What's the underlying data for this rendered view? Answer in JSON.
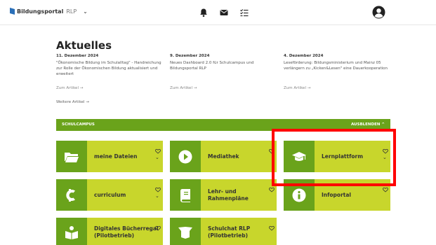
{
  "header": {
    "brand_bold": "Bildungsportal",
    "brand_suffix": "RLP",
    "icons": [
      "bell-icon",
      "mail-icon",
      "tasks-icon",
      "user-avatar-icon"
    ]
  },
  "news": {
    "title": "Aktuelles",
    "items": [
      {
        "date": "11. Dezember 2024",
        "text": "\"Ökonomische Bildung im Schulalltag\" - Handreichung zur Rolle der Ökonomischen Bildung aktualisiert und erweitert",
        "link": "Zum Artikel →"
      },
      {
        "date": "9. Dezember 2024",
        "text": "Neues Dashboard 2.0 für Schulcampus und Bildungsportal RLP",
        "link": "Zum Artikel →"
      },
      {
        "date": "4. Dezember 2024",
        "text": "Leseförderung: Bildungsministerium und Mainz 05 verlängern zu „Kicken&Lesen\" eine Dauerkooperation",
        "link": "Zum Artikel →"
      }
    ],
    "more": "Weitere Artikel →"
  },
  "campus": {
    "label": "SCHULCAMPUS",
    "hide": "AUSBLENDEN ^",
    "tiles": [
      {
        "label": "meine Dateien",
        "icon": "folder-icon"
      },
      {
        "label": "Mediathek",
        "icon": "play-icon"
      },
      {
        "label": "Lernplattform",
        "icon": "graduation-cap-icon"
      },
      {
        "label": "curriculum",
        "icon": "curriculum-logo-icon"
      },
      {
        "label": "Lehr- und Rahmenpläne",
        "icon": "book-icon"
      },
      {
        "label": "Infoportal",
        "icon": "info-icon"
      },
      {
        "label": "Digitales Bücherregal (Pilotbetrieb)",
        "icon": "reading-person-icon"
      },
      {
        "label": "Schulchat RLP (Pilotbetrieb)",
        "icon": "chat-icon"
      }
    ]
  },
  "colors": {
    "dark_green": "#6aa31b",
    "lime": "#c8d62c",
    "highlight": "#ff0000"
  }
}
